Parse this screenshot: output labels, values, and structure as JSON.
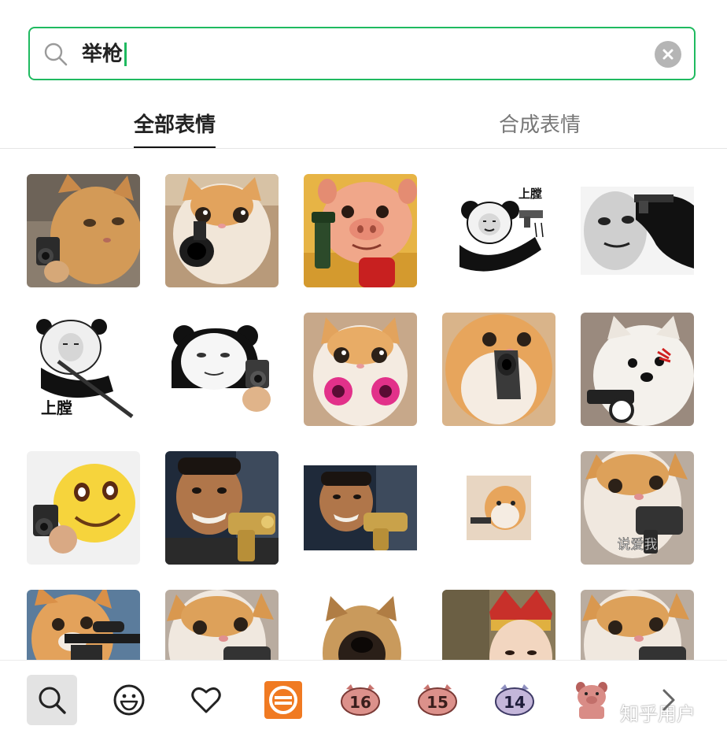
{
  "search": {
    "query": "举枪",
    "icon": "search-icon",
    "clear_icon": "clear-icon"
  },
  "tabs": [
    {
      "label": "全部表情",
      "active": true
    },
    {
      "label": "合成表情",
      "active": false
    }
  ],
  "stickers": [
    {
      "id": "cat-pointing-gun",
      "caption": ""
    },
    {
      "id": "kitten-gun-at-camera",
      "caption": ""
    },
    {
      "id": "cartoon-pig-with-gun",
      "caption": ""
    },
    {
      "id": "panda-meme-gun",
      "caption": "上膛"
    },
    {
      "id": "panda-face-gun-to-head",
      "caption": ""
    },
    {
      "id": "panda-rifle",
      "caption": "上膛"
    },
    {
      "id": "panda-holding-pistol",
      "caption": ""
    },
    {
      "id": "kitten-pink-guns",
      "caption": ""
    },
    {
      "id": "cat-gun-close",
      "caption": ""
    },
    {
      "id": "white-dog-gun",
      "caption": ""
    },
    {
      "id": "smiley-with-gun",
      "caption": ""
    },
    {
      "id": "man-golden-gun",
      "caption": ""
    },
    {
      "id": "man-golden-gun-small",
      "caption": ""
    },
    {
      "id": "tiny-cat-gun",
      "caption": ""
    },
    {
      "id": "cat-gun-love-you",
      "caption": "说爱我"
    },
    {
      "id": "cat-sniper-rifle",
      "caption": ""
    },
    {
      "id": "cat-gun-partial",
      "caption": ""
    },
    {
      "id": "dog-teeth",
      "caption": ""
    },
    {
      "id": "man-headdress",
      "caption": ""
    },
    {
      "id": "cat-gun-partial-2",
      "caption": ""
    }
  ],
  "bottom_bar": {
    "items": [
      {
        "name": "search",
        "icon": "search-icon",
        "active": true
      },
      {
        "name": "emoji",
        "icon": "smiley-icon"
      },
      {
        "name": "favorites",
        "icon": "heart-icon"
      },
      {
        "name": "sticker-pack-orange",
        "icon": "orange-pack-icon"
      },
      {
        "name": "pig-16",
        "label": "16"
      },
      {
        "name": "pig-15",
        "label": "15"
      },
      {
        "name": "pig-14",
        "label": "14"
      },
      {
        "name": "pig-pack",
        "icon": "pig-icon"
      }
    ],
    "watermark": "知乎用户",
    "more_icon": "chevron-right-icon"
  },
  "colors": {
    "accent": "#1fba60",
    "orange_pack": "#f07a22",
    "pig_badge": "#d98c86"
  }
}
